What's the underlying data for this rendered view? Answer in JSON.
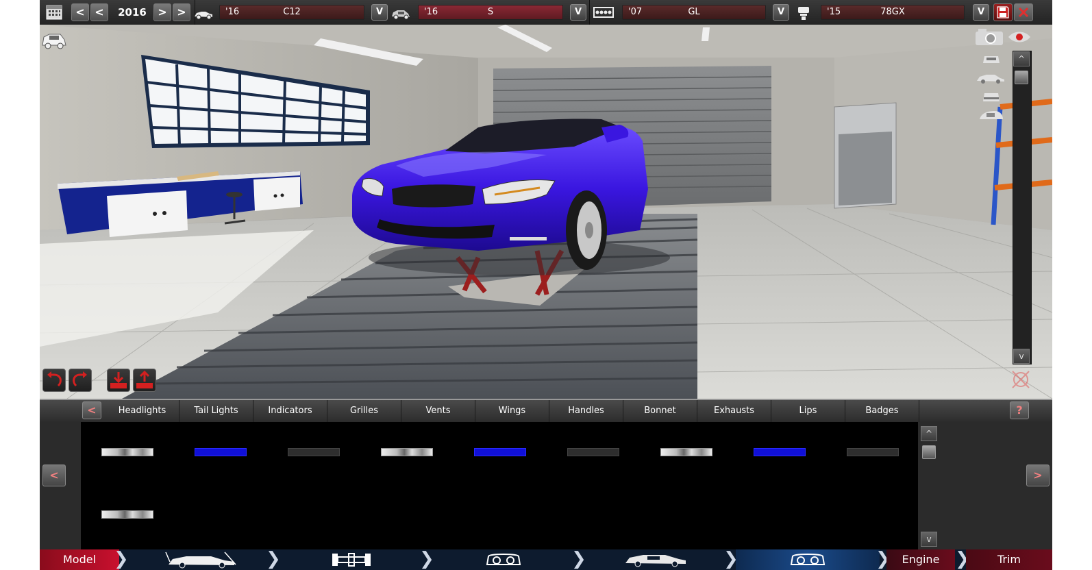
{
  "top_bar": {
    "year": "2016",
    "prev_label": "<",
    "next_label": ">",
    "selectors": [
      {
        "year": "'16",
        "model": "C12",
        "icon": "car-body-icon"
      },
      {
        "year": "'16",
        "model": "S",
        "icon": "car-trim-icon"
      },
      {
        "year": "'07",
        "model": "GL",
        "icon": "engine-block-icon"
      },
      {
        "year": "'15",
        "model": "78GX",
        "icon": "engine-piston-icon"
      }
    ],
    "dropdown_label": "V",
    "icons": [
      "calendar-icon",
      "save-icon",
      "close-icon"
    ]
  },
  "scene": {
    "car_color": "#3a16e0",
    "left_icon": "car-view-icon",
    "view_icons": [
      "camera-icon",
      "eye-icon",
      "car-front-view-icon",
      "car-side-view-icon",
      "car-rear-view-icon",
      "car-top-view-icon"
    ],
    "scroll_up": "^",
    "scroll_down": "v",
    "undo_icon": "undo-icon",
    "redo_icon": "redo-icon",
    "import_icon": "import-icon",
    "export_icon": "export-icon"
  },
  "parts": {
    "categories": [
      "Headlights",
      "Tail Lights",
      "Indicators",
      "Grilles",
      "Vents",
      "Wings",
      "Handles",
      "Bonnet",
      "Exhausts",
      "Lips",
      "Badges"
    ],
    "prev_label": "<",
    "next_label": ">",
    "help_label": "?",
    "scroll_up": "^",
    "scroll_down": "v",
    "swatches": [
      "light",
      "blue",
      "dark",
      "light",
      "blue",
      "dark",
      "light",
      "blue",
      "dark",
      "light"
    ]
  },
  "bottom_nav": {
    "items": [
      {
        "label": "Model",
        "active": true
      },
      {
        "label": "",
        "icon": "car-body-dimensions-icon"
      },
      {
        "label": "",
        "icon": "car-chassis-icon"
      },
      {
        "label": "",
        "icon": "car-fixtures-icon"
      },
      {
        "label": "",
        "icon": "car-interior-icon"
      },
      {
        "label": "",
        "icon": "car-fixtures-detail-icon",
        "current": true
      },
      {
        "label": "Engine"
      },
      {
        "label": "Trim"
      }
    ]
  },
  "colors": {
    "accent_red": "#c8102e",
    "nav_blue": "#0d1b2e",
    "selector_red": "#8a2834"
  }
}
